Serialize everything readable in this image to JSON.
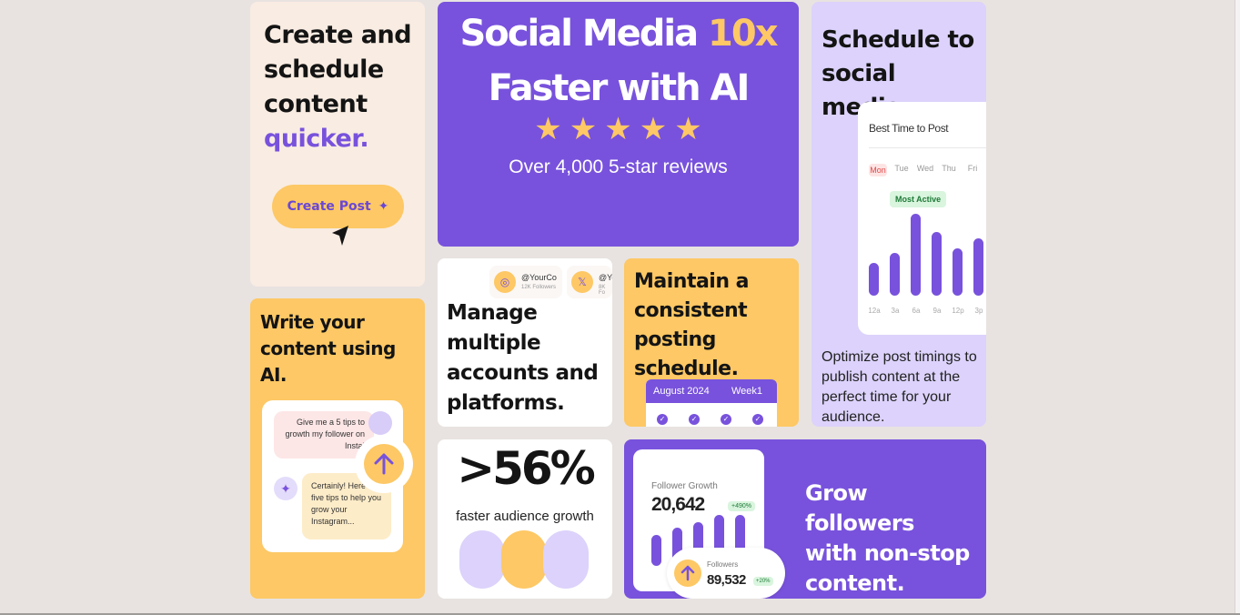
{
  "card_create": {
    "line1": "Create and",
    "line2": "schedule",
    "line3": "content",
    "accent": "quicker.",
    "button_label": "Create Post"
  },
  "hero": {
    "title_part1": "Social Media ",
    "title_highlight": "10x",
    "title_line2": "Faster with AI",
    "stars": 5,
    "reviews": "Over 4,000 5-star reviews"
  },
  "card_schedule": {
    "line1": "Schedule to",
    "line2": "social media.",
    "panel_title": "Best Time to Post",
    "days": [
      "Mon",
      "Tue",
      "Wed",
      "Thu",
      "Fri"
    ],
    "badge": "Most Active",
    "hours": [
      "12a",
      "3a",
      "6a",
      "9a",
      "12p",
      "3p"
    ],
    "bar_levels": [
      0.4,
      0.52,
      1.0,
      0.78,
      0.58,
      0.7
    ],
    "description": "Optimize post timings to publish content at the perfect time for your audience."
  },
  "card_write": {
    "line1": "Write your",
    "line2": "content using AI.",
    "user_message": "Give me a 5 tips to growth my follower on Insta!",
    "ai_message": "Certainly! Here are five tips to help you grow your Instagram..."
  },
  "card_accounts": {
    "chips": [
      {
        "handle": "@YourCo",
        "followers": "12K Followers"
      },
      {
        "handle": "@Yo",
        "followers": "8K Fo"
      }
    ],
    "line1": "Manage",
    "line2": "multiple",
    "line3": "accounts and",
    "line4": "platforms."
  },
  "card_consistent": {
    "line1": "Maintain a",
    "line2": "consistent",
    "line3": "posting",
    "line4": "schedule.",
    "calendar_month": "August 2024",
    "calendar_week": "Week1"
  },
  "card_stat": {
    "value": ">56%",
    "label": "faster audience growth"
  },
  "card_grow": {
    "panel_label": "Follower Growth",
    "panel_value": "20,642",
    "panel_change": "+490%",
    "bar_levels": [
      0.6,
      0.75,
      0.85,
      1.0,
      1.0
    ],
    "followers_label": "Followers",
    "followers_value": "89,532",
    "followers_change": "+20%",
    "line1": "Grow followers",
    "line2": "with non-stop",
    "line3": "content."
  },
  "colors": {
    "purple": "#7852dc",
    "yellow": "#fdc865",
    "lavender": "#dcd2fb",
    "cream": "#f9ece2"
  }
}
